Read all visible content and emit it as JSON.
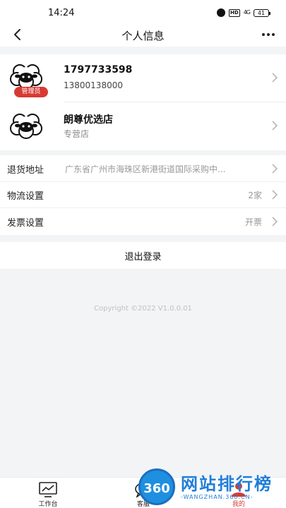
{
  "status_bar": {
    "time": "14:24",
    "hd_label": "HD",
    "signal_label": "4G",
    "battery": "41"
  },
  "nav": {
    "title": "个人信息"
  },
  "account": {
    "user": {
      "badge": "管理员",
      "name": "1797733598",
      "phone": "13800138000"
    },
    "store": {
      "name": "朗尊优选店",
      "type": "专营店"
    }
  },
  "settings": [
    {
      "label": "退货地址",
      "value": "广东省广州市海珠区新港街道国际采购中..."
    },
    {
      "label": "物流设置",
      "value": "2家"
    },
    {
      "label": "发票设置",
      "value": "开票"
    }
  ],
  "logout_label": "退出登录",
  "copyright": "Copyright ©2022 V1.0.0.01",
  "tabs": [
    {
      "label": "工作台",
      "icon": "monitor-icon"
    },
    {
      "label": "客服",
      "icon": "chat-icon"
    },
    {
      "label": "我的",
      "icon": "user-icon"
    }
  ],
  "watermark": {
    "logo_text": "360",
    "title": "网站排行榜",
    "subtitle": "-WANGZHAN.360.CN-"
  },
  "colors": {
    "accent": "#d83a32",
    "background": "#f3f4f6",
    "watermark_blue": "#1f7ed8"
  }
}
